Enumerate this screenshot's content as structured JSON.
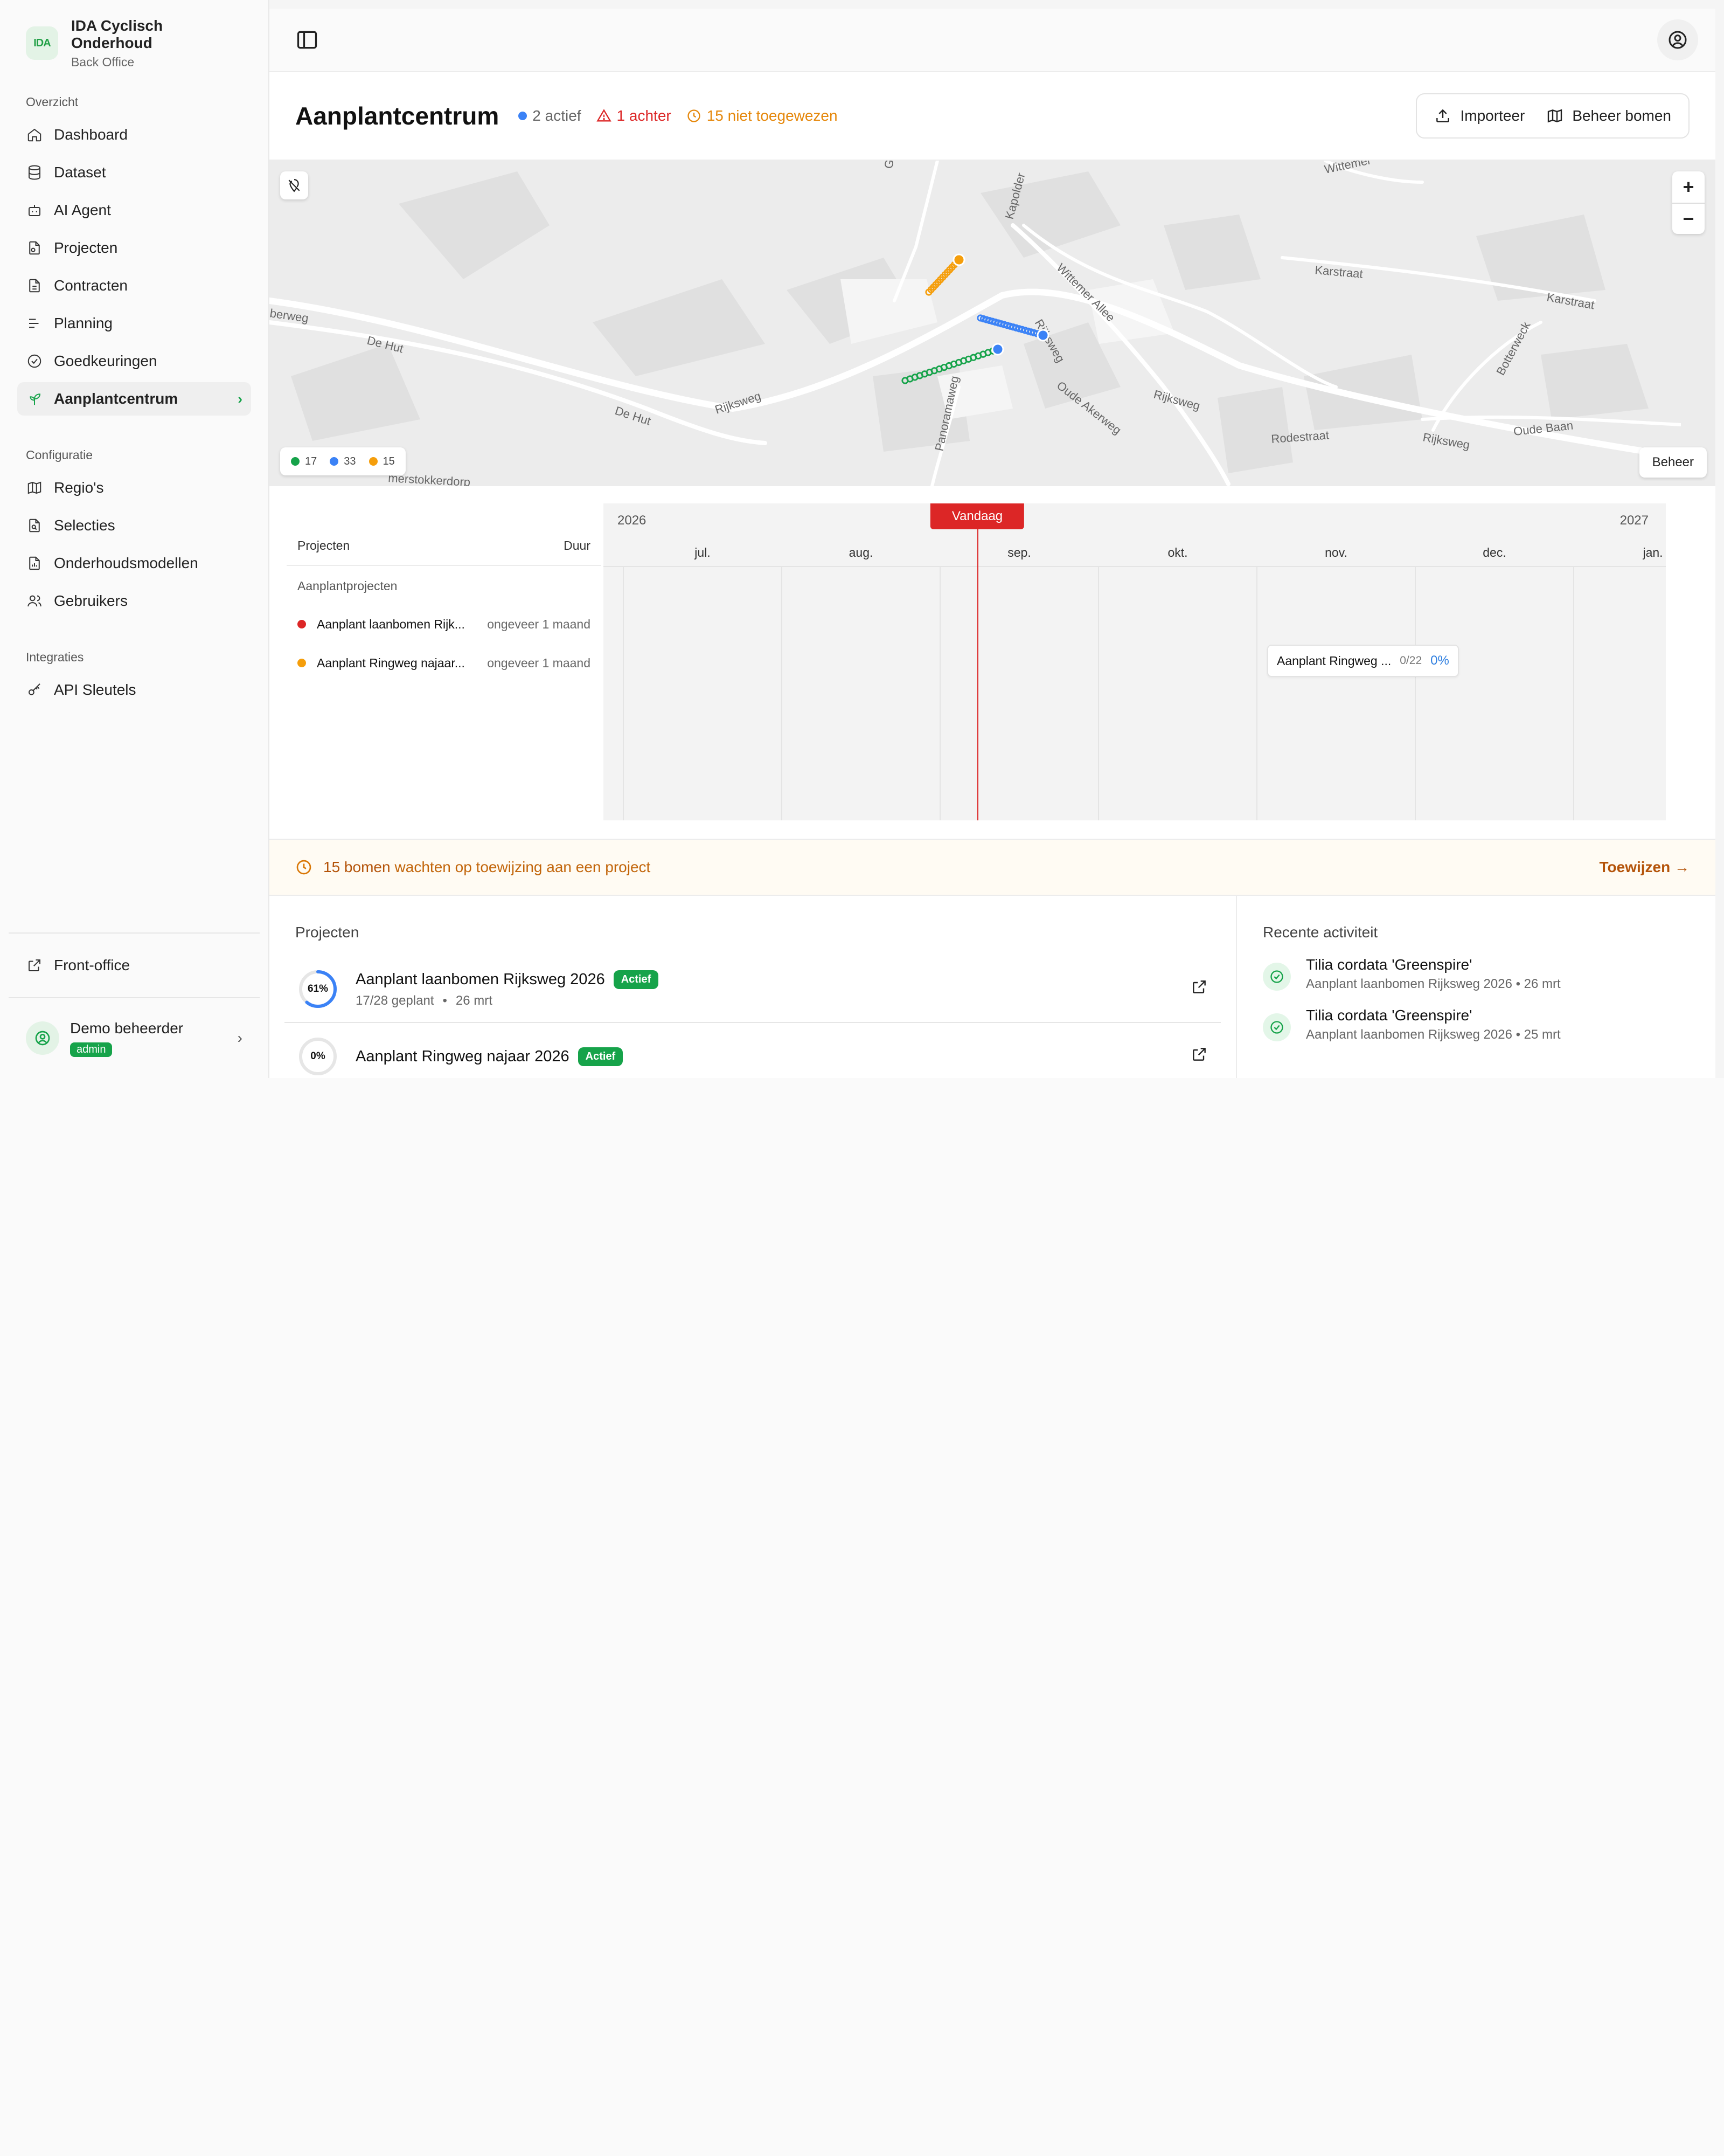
{
  "brand": {
    "logo_text": "IDA",
    "title": "IDA Cyclisch Onderhoud",
    "subtitle": "Back Office"
  },
  "sidebar": {
    "section_overview": "Overzicht",
    "overview_items": [
      {
        "label": "Dashboard",
        "icon": "home-icon"
      },
      {
        "label": "Dataset",
        "icon": "database-icon"
      },
      {
        "label": "AI Agent",
        "icon": "bot-icon"
      },
      {
        "label": "Projecten",
        "icon": "file-settings-icon"
      },
      {
        "label": "Contracten",
        "icon": "file-list-icon"
      },
      {
        "label": "Planning",
        "icon": "planning-icon"
      },
      {
        "label": "Goedkeuringen",
        "icon": "check-circle-icon"
      },
      {
        "label": "Aanplantcentrum",
        "icon": "sprout-icon",
        "active": true
      }
    ],
    "section_config": "Configuratie",
    "config_items": [
      {
        "label": "Regio's",
        "icon": "map-icon"
      },
      {
        "label": "Selecties",
        "icon": "file-search-icon"
      },
      {
        "label": "Onderhoudsmodellen",
        "icon": "file-chart-icon"
      },
      {
        "label": "Gebruikers",
        "icon": "users-icon"
      }
    ],
    "section_integrations": "Integraties",
    "integration_items": [
      {
        "label": "API Sleutels",
        "icon": "key-icon"
      }
    ],
    "front_office": "Front-office",
    "user": {
      "name": "Demo beheerder",
      "role": "admin"
    }
  },
  "header": {
    "title": "Aanplantcentrum",
    "stat_active": "2 actief",
    "stat_behind": "1 achter",
    "stat_unassigned": "15 niet toegewezen",
    "import_label": "Importeer",
    "manage_trees_label": "Beheer bomen"
  },
  "map": {
    "street_labels": [
      "De Hut",
      "De Hut",
      "Rijksweg",
      "Rijksweg",
      "Rijksweg",
      "Rijksweg",
      "Wittemer Allee",
      "Kapolder",
      "Karstraat",
      "Karstraat",
      "Rodestraat",
      "Oude Baan",
      "Oude Akerweg",
      "Panoramaweg",
      "Botterweck",
      "Wittemer",
      "berweg",
      "merstokkerdorp",
      "G"
    ],
    "legend": {
      "green": "17",
      "blue": "33",
      "orange": "15"
    },
    "manage_label": "Beheer",
    "zoom_in": "+",
    "zoom_out": "−"
  },
  "timeline": {
    "col_projects": "Projecten",
    "col_duration": "Duur",
    "group_label": "Aanplantprojecten",
    "rows": [
      {
        "name": "Aanplant laanbomen Rijk...",
        "duration": "ongeveer 1 maand",
        "color": "#dc2626"
      },
      {
        "name": "Aanplant Ringweg najaar...",
        "duration": "ongeveer 1 maand",
        "color": "#f59e0b"
      }
    ],
    "years": [
      "2026",
      "2027"
    ],
    "months": [
      "jul.",
      "aug.",
      "sep.",
      "okt.",
      "nov.",
      "dec.",
      "jan."
    ],
    "today_label": "Vandaag",
    "bar": {
      "name": "Aanplant Ringweg ...",
      "count": "0/22",
      "percent": "0%"
    }
  },
  "banner": {
    "count_text": "15 bomen",
    "text": "wachten op toewijzing aan een project",
    "action": "Toewijzen →"
  },
  "projects": {
    "title": "Projecten",
    "items": [
      {
        "name": "Aanplant laanbomen Rijksweg 2026",
        "badge": "Actief",
        "progress_label": "61%",
        "progress": 0.61,
        "planted": "17/28 geplant",
        "date": "26 mrt"
      },
      {
        "name": "Aanplant Ringweg najaar 2026",
        "badge": "Actief",
        "progress_label": "0%",
        "progress": 0,
        "planted": "",
        "date": ""
      }
    ]
  },
  "activity": {
    "title": "Recente activiteit",
    "items": [
      {
        "title": "Tilia cordata 'Greenspire'",
        "sub": "Aanplant laanbomen Rijksweg 2026 • 26 mrt"
      },
      {
        "title": "Tilia cordata 'Greenspire'",
        "sub": "Aanplant laanbomen Rijksweg 2026 • 25 mrt"
      }
    ]
  },
  "colors": {
    "accent": "#16a34a",
    "danger": "#dc2626",
    "warning": "#f59e0b",
    "info": "#3b82f6"
  }
}
